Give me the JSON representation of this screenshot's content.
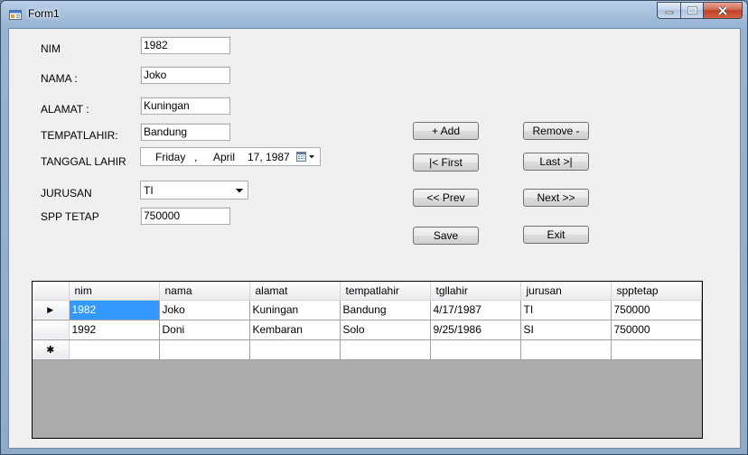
{
  "window": {
    "title": "Form1",
    "icons": {
      "app": "form-app-icon",
      "minimize": "minimize-icon",
      "maximize": "maximize-icon",
      "close": "close-icon"
    },
    "colors": {
      "client_bg": "#f0f0f0",
      "close_btn": "#c2412a",
      "selection": "#3399ff",
      "grid_bg": "#ababab"
    }
  },
  "form": {
    "nim": {
      "label": "NIM",
      "value": "1982"
    },
    "nama": {
      "label": "NAMA :",
      "value": "Joko"
    },
    "alamat": {
      "label": "ALAMAT :",
      "value": "Kuningan"
    },
    "tempatlahir": {
      "label": "TEMPATLAHIR:",
      "value": "Bandung"
    },
    "tanggal_lahir": {
      "label": "TANGGAL LAHIR",
      "day": "Friday",
      "sep": ",",
      "month": "April",
      "date_year": "17, 1987",
      "icon": "calendar-dropdown-icon"
    },
    "jurusan": {
      "label": "JURUSAN",
      "value": "TI",
      "icon": "chevron-down-icon"
    },
    "spp_tetap": {
      "label": "SPP TETAP",
      "value": "750000"
    }
  },
  "buttons": {
    "add": "+ Add",
    "remove": "Remove -",
    "first": "|< First",
    "last": "Last >|",
    "prev": "<< Prev",
    "next": "Next >>",
    "save": "Save",
    "exit": "Exit"
  },
  "grid": {
    "columns": [
      "nim",
      "nama",
      "alamat",
      "tempatlahir",
      "tgllahir",
      "jurusan",
      "spptetap"
    ],
    "rows": [
      [
        "1982",
        "Joko",
        "Kuningan",
        "Bandung",
        "4/17/1987",
        "TI",
        "750000"
      ],
      [
        "1992",
        "Doni",
        "Kembaran",
        "Solo",
        "9/25/1986",
        "SI",
        "750000"
      ]
    ],
    "current_row_marker": "▶",
    "new_row_marker": "✱"
  }
}
